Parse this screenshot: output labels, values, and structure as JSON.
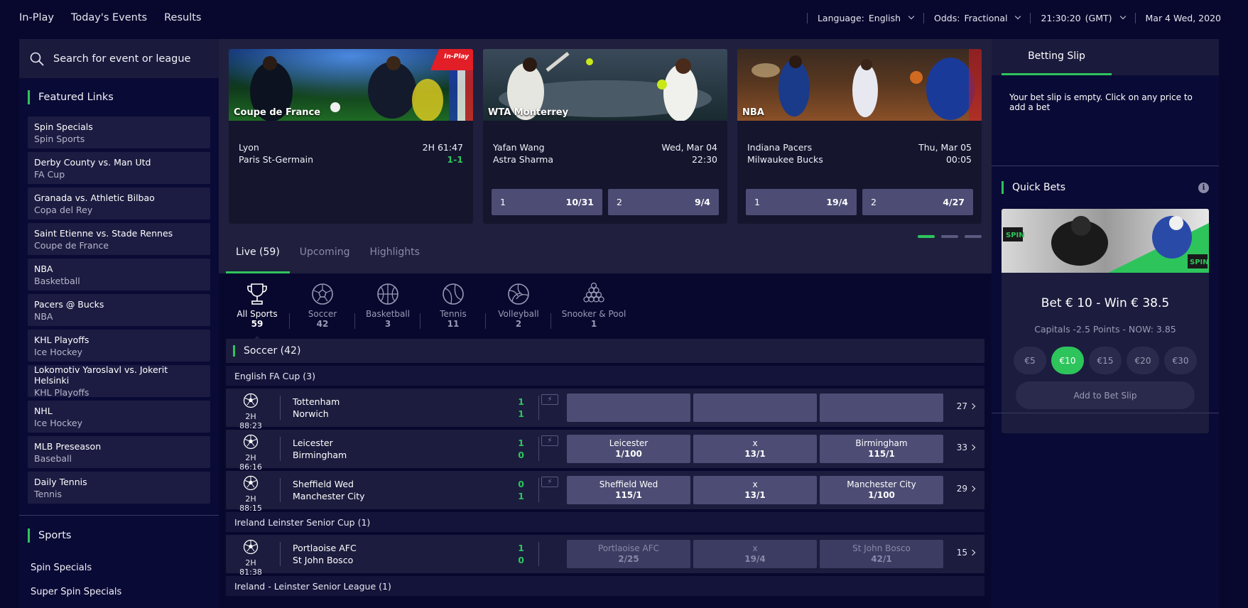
{
  "topnav": {
    "inplay": "In-Play",
    "today": "Today's Events",
    "results": "Results"
  },
  "topright": {
    "language_label": "Language:",
    "language_value": "English",
    "odds_label": "Odds:",
    "odds_value": "Fractional",
    "time": "21:30:20",
    "tz": "(GMT)",
    "date": "Mar 4 Wed, 2020"
  },
  "search": {
    "placeholder": "Search for event or league"
  },
  "featured": {
    "title": "Featured Links",
    "items": [
      {
        "title": "Spin Specials",
        "sub": "Spin Sports"
      },
      {
        "title": "Derby County vs. Man Utd",
        "sub": "FA Cup"
      },
      {
        "title": "Granada vs. Athletic Bilbao",
        "sub": "Copa del Rey"
      },
      {
        "title": "Saint Etienne vs. Stade Rennes",
        "sub": "Coupe de France"
      },
      {
        "title": "NBA",
        "sub": "Basketball"
      },
      {
        "title": "Pacers @ Bucks",
        "sub": "NBA"
      },
      {
        "title": "KHL Playoffs",
        "sub": "Ice Hockey"
      },
      {
        "title": "Lokomotiv Yaroslavl vs. Jokerit Helsinki",
        "sub": "KHL Playoffs"
      },
      {
        "title": "NHL",
        "sub": "Ice Hockey"
      },
      {
        "title": "MLB Preseason",
        "sub": "Baseball"
      },
      {
        "title": "Daily Tennis",
        "sub": "Tennis"
      }
    ]
  },
  "sports": {
    "title": "Sports",
    "items": [
      "Spin Specials",
      "Super Spin Specials"
    ]
  },
  "cards": [
    {
      "caption": "Coupe de France",
      "badge": "In-Play",
      "team1": "Lyon",
      "team2": "Paris St-Germain",
      "info1": "2H 61:47",
      "info2": "1-1"
    },
    {
      "caption": "WTA Monterrey",
      "team1": "Yafan Wang",
      "team2": "Astra Sharma",
      "info1": "Wed, Mar 04",
      "info2": "22:30",
      "odds": [
        {
          "label": "1",
          "price": "10/31"
        },
        {
          "label": "2",
          "price": "9/4"
        }
      ]
    },
    {
      "caption": "NBA",
      "team1": "Indiana Pacers",
      "team2": "Milwaukee Bucks",
      "info1": "Thu, Mar 05",
      "info2": "00:05",
      "odds": [
        {
          "label": "1",
          "price": "19/4"
        },
        {
          "label": "2",
          "price": "4/27"
        }
      ]
    }
  ],
  "tabs": {
    "live": "Live (59)",
    "upcoming": "Upcoming",
    "highlights": "Highlights"
  },
  "sport_filters": [
    {
      "name": "All Sports",
      "count": "59"
    },
    {
      "name": "Soccer",
      "count": "42"
    },
    {
      "name": "Basketball",
      "count": "3"
    },
    {
      "name": "Tennis",
      "count": "11"
    },
    {
      "name": "Volleyball",
      "count": "2"
    },
    {
      "name": "Snooker & Pool",
      "count": "1"
    }
  ],
  "soccer_header": "Soccer (42)",
  "leagues": {
    "fa_cup": "English FA Cup  (3)",
    "leinster_cup": "Ireland Leinster Senior Cup  (1)",
    "leinster_league": "Ireland - Leinster Senior League  (1)"
  },
  "events": [
    {
      "clock": "2H 88:23",
      "home": "Tottenham",
      "away": "Norwich",
      "hs": "1",
      "as": "1",
      "o1n": "",
      "o1p": "",
      "oxn": "",
      "oxp": "",
      "o2n": "",
      "o2p": "",
      "more": "27"
    },
    {
      "clock": "2H 86:16",
      "home": "Leicester",
      "away": "Birmingham",
      "hs": "1",
      "as": "0",
      "o1n": "Leicester",
      "o1p": "1/100",
      "oxn": "x",
      "oxp": "13/1",
      "o2n": "Birmingham",
      "o2p": "115/1",
      "more": "33"
    },
    {
      "clock": "2H 88:15",
      "home": "Sheffield Wed",
      "away": "Manchester City",
      "hs": "0",
      "as": "1",
      "o1n": "Sheffield Wed",
      "o1p": "115/1",
      "oxn": "x",
      "oxp": "13/1",
      "o2n": "Manchester City",
      "o2p": "1/100",
      "more": "29"
    },
    {
      "clock": "2H 81:38",
      "home": "Portlaoise AFC",
      "away": "St John Bosco",
      "hs": "1",
      "as": "0",
      "o1n": "Portlaoise AFC",
      "o1p": "2/25",
      "oxn": "x",
      "oxp": "19/4",
      "o2n": "St John Bosco",
      "o2p": "42/1",
      "more": "15"
    }
  ],
  "betslip": {
    "tab": "Betting Slip",
    "empty": "Your bet slip is empty. Click on any price to add a bet"
  },
  "quickbets": {
    "title": "Quick Bets",
    "bet": "Bet € 10 - Win € 38.5",
    "caption": "Capitals -2.5 Points - NOW: 3.85",
    "stakes": [
      "€5",
      "€10",
      "€15",
      "€20",
      "€30"
    ],
    "add": "Add to Bet Slip"
  },
  "colors": {
    "accent": "#2ec45c",
    "bg": "#08082e",
    "panel": "#1c1c3e",
    "odds": "#4c4c74"
  }
}
